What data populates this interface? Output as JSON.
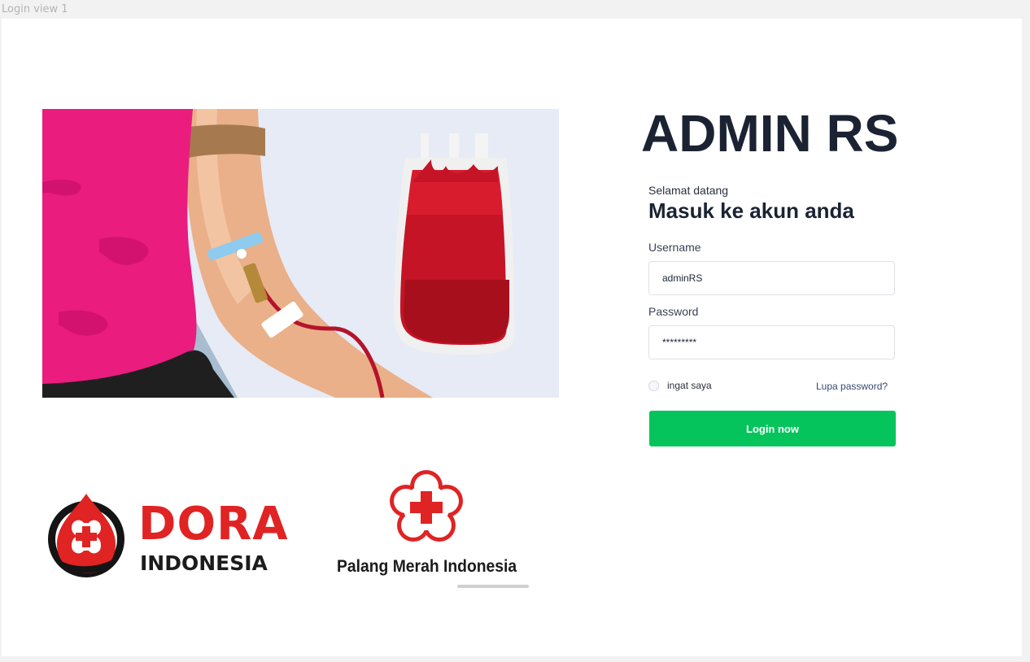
{
  "frame": {
    "label": "Login view 1"
  },
  "login": {
    "title": "ADMIN RS",
    "welcome": "Selamat datang",
    "subtitle": "Masuk ke akun anda",
    "username_label": "Username",
    "username_value": "adminRS",
    "password_label": "Password",
    "password_value": "*********",
    "remember_label": "ingat saya",
    "forgot_label": "Lupa password?",
    "submit_label": "Login now"
  },
  "logos": {
    "dora": {
      "name": "DORA",
      "sub": "INDONESIA"
    },
    "pmi": {
      "name": "Palang Merah Indonesia"
    }
  },
  "colors": {
    "accent_green": "#06c45c",
    "brand_red": "#e02323",
    "title_dark": "#1b2333"
  },
  "icons": [
    "blood-donation-illustration",
    "dora-logo-icon",
    "pmi-cross-icon"
  ]
}
